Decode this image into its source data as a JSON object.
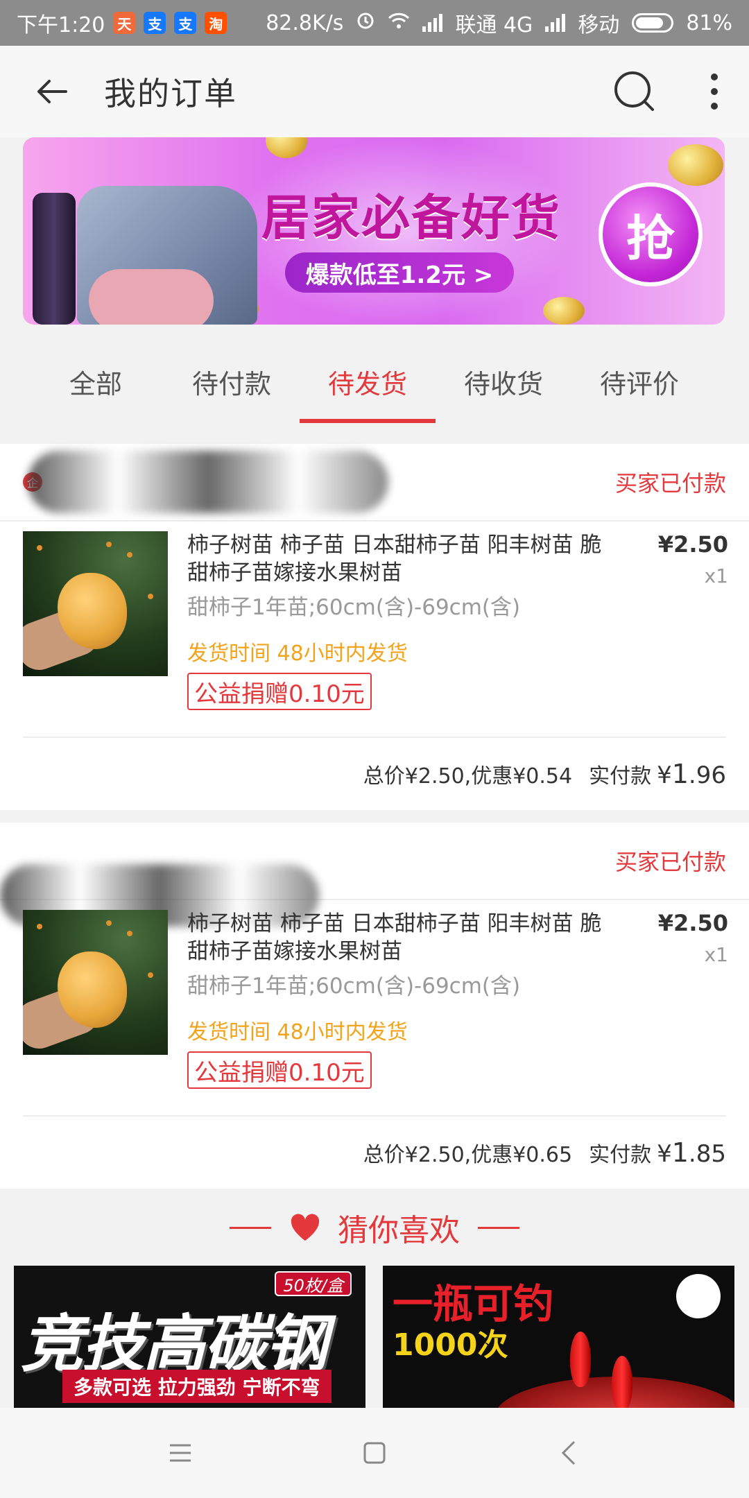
{
  "status_bar": {
    "time": "下午1:20",
    "speed": "82.8K/s",
    "carrier1": "联通 4G",
    "carrier2": "移动",
    "battery": "81%",
    "battery_level": 0.81,
    "app_icons": [
      "tmall-icon",
      "alipay-icon",
      "alipay-icon",
      "taobao-icon"
    ]
  },
  "header": {
    "title": "我的订单"
  },
  "banner": {
    "title": "居家必备好货",
    "subtitle": "爆款低至1.2元 >",
    "badge": "抢"
  },
  "tabs": [
    {
      "label": "全部",
      "active": false
    },
    {
      "label": "待付款",
      "active": false
    },
    {
      "label": "待发货",
      "active": true
    },
    {
      "label": "待收货",
      "active": false
    },
    {
      "label": "待评价",
      "active": false
    }
  ],
  "orders": [
    {
      "status": "买家已付款",
      "item": {
        "title": "柿子树苗 柿子苗 日本甜柿子苗  阳丰树苗 脆甜柿子苗嫁接水果树苗",
        "spec": "甜柿子1年苗;60cm(含)-69cm(含)",
        "shipping": "发货时间 48小时内发货",
        "tag": "公益捐赠0.10元",
        "price": "¥2.50",
        "qty": "x1"
      },
      "summary": {
        "total": "总价¥2.50,优惠¥0.54",
        "paid_label": "实付款",
        "paid_symbol": "¥",
        "paid_int": "1",
        "paid_dec": ".96"
      }
    },
    {
      "status": "买家已付款",
      "item": {
        "title": "柿子树苗 柿子苗 日本甜柿子苗  阳丰树苗 脆甜柿子苗嫁接水果树苗",
        "spec": "甜柿子1年苗;60cm(含)-69cm(含)",
        "shipping": "发货时间 48小时内发货",
        "tag": "公益捐赠0.10元",
        "price": "¥2.50",
        "qty": "x1"
      },
      "summary": {
        "total": "总价¥2.50,优惠¥0.65",
        "paid_label": "实付款",
        "paid_symbol": "¥",
        "paid_int": "1",
        "paid_dec": ".85"
      }
    }
  ],
  "recommend": {
    "title": "猜你喜欢",
    "cards": [
      {
        "title": "竞技高碳钢",
        "badge": "50枚/盒",
        "strip": "多款可选 拉力强劲 宁断不弯"
      },
      {
        "title": "一瓶可钓",
        "subtitle": "1000次"
      }
    ]
  },
  "colors": {
    "accent": "#e4393c",
    "shipping": "#f2a31a",
    "muted": "#999999"
  }
}
